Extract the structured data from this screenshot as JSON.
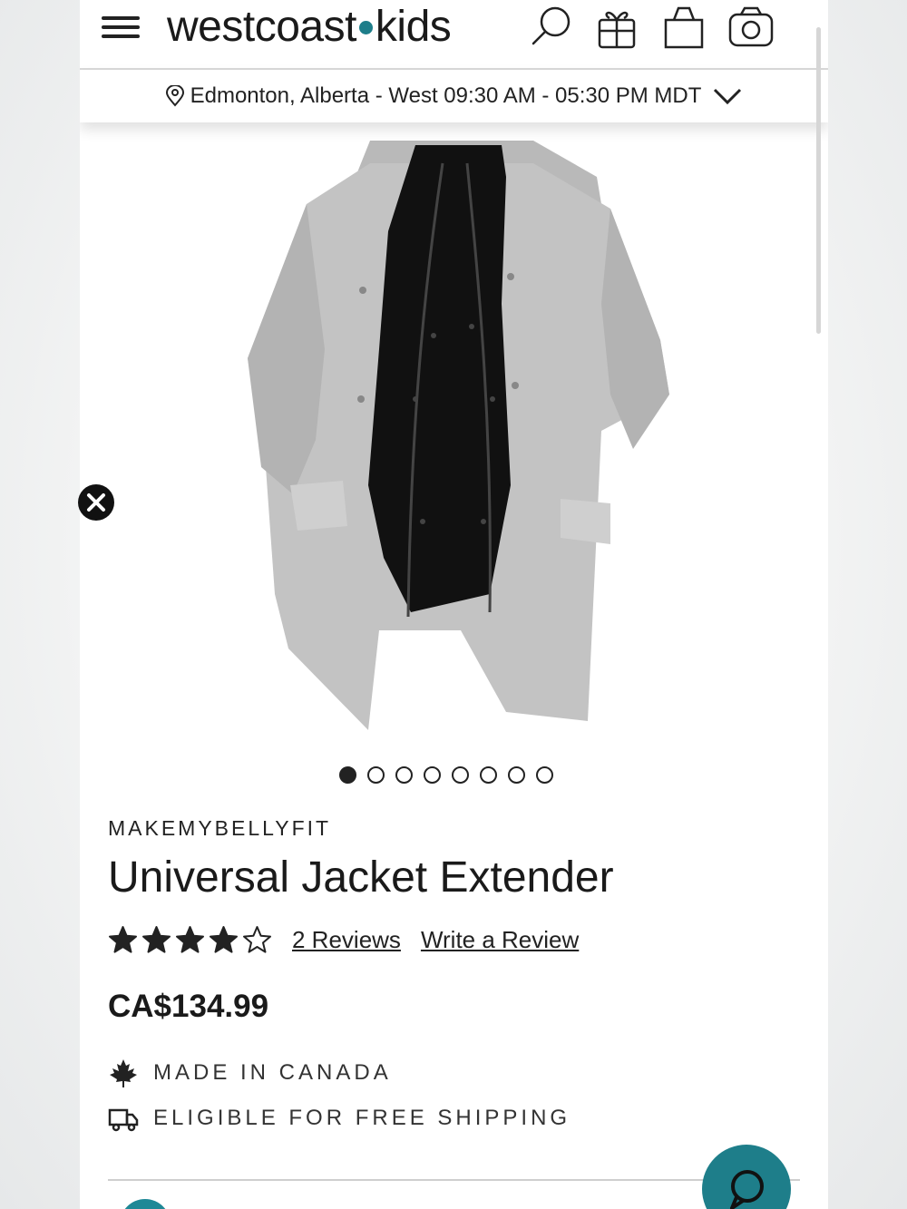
{
  "header": {
    "logo_left": "westcoast",
    "logo_right": "kids",
    "icons": [
      "menu-icon",
      "search-icon",
      "gift-icon",
      "bag-icon",
      "camera-icon"
    ]
  },
  "location": {
    "text": "Edmonton, Alberta - West 09:30 AM - 05:30 PM MDT"
  },
  "gallery": {
    "total_images": 8,
    "active_index": 0
  },
  "product": {
    "brand": "MAKEMYBELLYFIT",
    "name": "Universal Jacket Extender",
    "rating": 4,
    "rating_max": 5,
    "reviews_label": "2 Reviews",
    "write_review_label": "Write a Review",
    "price": "CA$134.99"
  },
  "features": [
    {
      "icon": "maple-leaf-icon",
      "label": "MADE IN CANADA"
    },
    {
      "icon": "truck-icon",
      "label": "ELIGIBLE FOR FREE SHIPPING"
    }
  ],
  "colors": {
    "accent": "#1e7e8a",
    "text": "#222222"
  }
}
